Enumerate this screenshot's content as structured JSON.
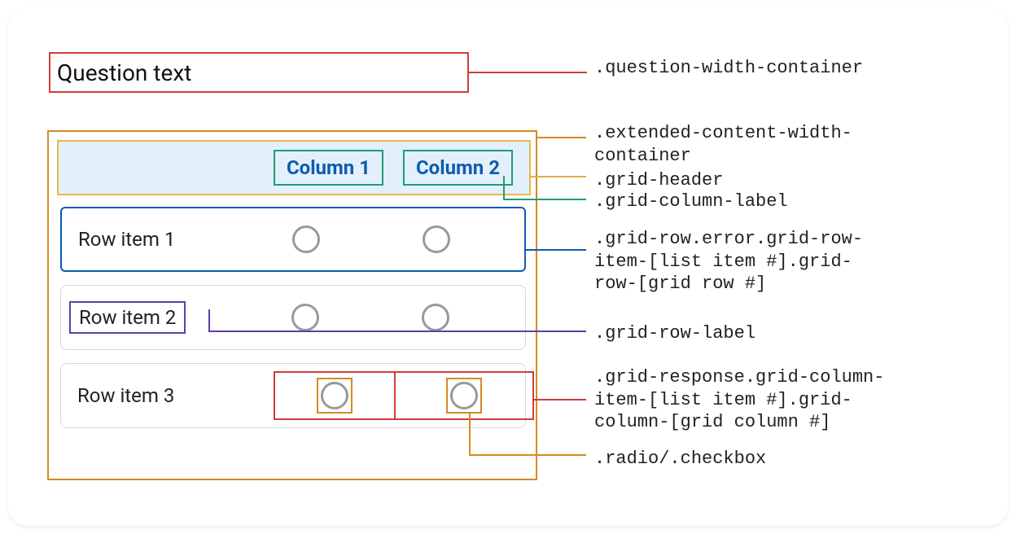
{
  "question": {
    "text": "Question text"
  },
  "grid": {
    "columns": [
      {
        "label": "Column 1"
      },
      {
        "label": "Column 2"
      }
    ],
    "rows": [
      {
        "label": "Row item 1"
      },
      {
        "label": "Row item 2"
      },
      {
        "label": "Row item 3"
      }
    ]
  },
  "annotations": {
    "question_container": ".question-width-container",
    "extended_container": ".extended-content-width-\ncontainer",
    "grid_header": ".grid-header",
    "grid_column_label": ".grid-column-label",
    "grid_row_error": ".grid-row.error.grid-row-\nitem-[list item #].grid-\nrow-[grid row #]",
    "grid_row_label": ".grid-row-label",
    "grid_response": ".grid-response.grid-column-\nitem-[list item #].grid-\ncolumn-[grid column #]",
    "radio_checkbox": ".radio/.checkbox"
  },
  "colors": {
    "red": "#d13c3c",
    "orange": "#d38b21",
    "gold": "#e9b949",
    "headerbg": "#e3effb",
    "green": "#1f9e6f",
    "blue": "#0b5cad",
    "purple": "#5e3fa3"
  }
}
